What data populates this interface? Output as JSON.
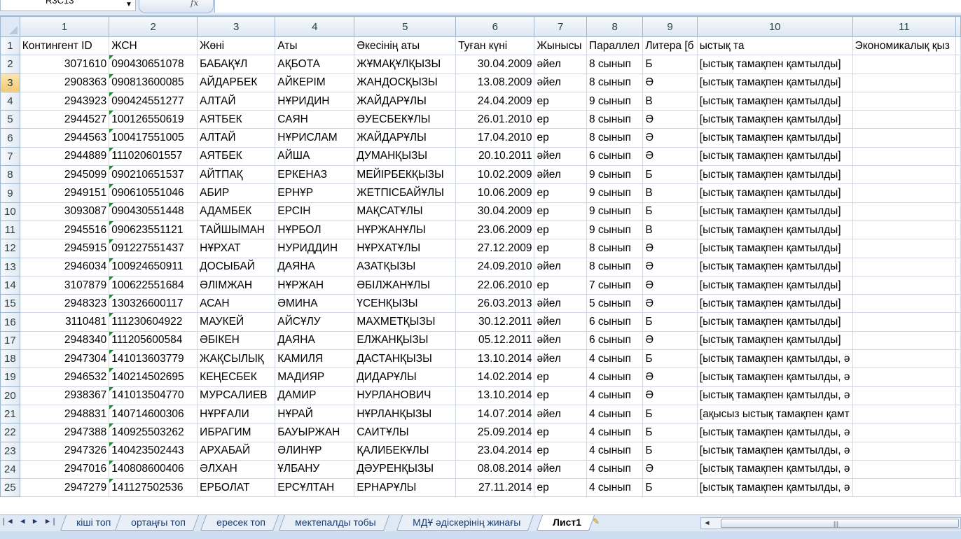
{
  "formula_bar": {
    "name_box": "R3C13",
    "fx_label": "fx",
    "formula": ""
  },
  "grid": {
    "column_headers": [
      "1",
      "2",
      "3",
      "4",
      "5",
      "6",
      "7",
      "8",
      "9",
      "10",
      "11"
    ],
    "header_row": {
      "id": "1",
      "cells": [
        "Контингент ID",
        "ЖСН",
        "Жөні",
        "Аты",
        "Әкесінің аты",
        "Туған күні",
        "Жынысы",
        "Параллел",
        "Литера [б",
        "ыстық та",
        "Экономикалық қыз"
      ]
    },
    "rows": [
      {
        "id": "2",
        "cells": [
          "3071610",
          "090430651078",
          "БАБАҚҰЛ",
          "АҚБОТА",
          "ЖҰМАҚҰЛҚЫЗЫ",
          "30.04.2009",
          "әйел",
          "8 сынып",
          "Б",
          "[ыстық тамақпен қамтылды]",
          ""
        ]
      },
      {
        "id": "3",
        "cells": [
          "2908363",
          "090813600085",
          "АЙДАРБЕК",
          "АЙКЕРІМ",
          "ЖАНДОСҚЫЗЫ",
          "13.08.2009",
          "әйел",
          "8 сынып",
          "Ә",
          "[ыстық тамақпен қамтылды]",
          ""
        ]
      },
      {
        "id": "4",
        "cells": [
          "2943923",
          "090424551277",
          "АЛТАЙ",
          "НҰРИДИН",
          "ЖАЙДАРҰЛЫ",
          "24.04.2009",
          "ер",
          "9 сынып",
          "В",
          "[ыстық тамақпен қамтылды]",
          ""
        ]
      },
      {
        "id": "5",
        "cells": [
          "2944527",
          "100126550619",
          "АЯТБЕК",
          "САЯН",
          "ӘУЕСБЕКҰЛЫ",
          "26.01.2010",
          "ер",
          "8 сынып",
          "Ә",
          "[ыстық тамақпен қамтылды]",
          ""
        ]
      },
      {
        "id": "6",
        "cells": [
          "2944563",
          "100417551005",
          "АЛТАЙ",
          "НҰРИСЛАМ",
          "ЖАЙДАРҰЛЫ",
          "17.04.2010",
          "ер",
          "8 сынып",
          "Ә",
          "[ыстық тамақпен қамтылды]",
          ""
        ]
      },
      {
        "id": "7",
        "cells": [
          "2944889",
          "111020601557",
          "АЯТБЕК",
          "АЙША",
          "ДУМАНҚЫЗЫ",
          "20.10.2011",
          "әйел",
          "6 сынып",
          "Ә",
          "[ыстық тамақпен қамтылды]",
          ""
        ]
      },
      {
        "id": "8",
        "cells": [
          "2945099",
          "090210651537",
          "АЙТПАҚ",
          "ЕРКЕНАЗ",
          "МЕЙІРБЕКҚЫЗЫ",
          "10.02.2009",
          "әйел",
          "9 сынып",
          "Б",
          "[ыстық тамақпен қамтылды]",
          ""
        ]
      },
      {
        "id": "9",
        "cells": [
          "2949151",
          "090610551046",
          "АБИР",
          "ЕРНҰР",
          "ЖЕТПІСБАЙҰЛЫ",
          "10.06.2009",
          "ер",
          "9 сынып",
          "В",
          "[ыстық тамақпен қамтылды]",
          ""
        ]
      },
      {
        "id": "10",
        "cells": [
          "3093087",
          "090430551448",
          "АДАМБЕК",
          "ЕРСІН",
          "МАҚСАТҰЛЫ",
          "30.04.2009",
          "ер",
          "9 сынып",
          "Б",
          "[ыстық тамақпен қамтылды]",
          ""
        ]
      },
      {
        "id": "11",
        "cells": [
          "2945516",
          "090623551121",
          "ТАЙШЫМАН",
          "НҰРБОЛ",
          "НҰРЖАНҰЛЫ",
          "23.06.2009",
          "ер",
          "9 сынып",
          "В",
          "[ыстық тамақпен қамтылды]",
          ""
        ]
      },
      {
        "id": "12",
        "cells": [
          "2945915",
          "091227551437",
          "НҰРХАТ",
          "НУРИДДИН",
          "НҰРХАТҰЛЫ",
          "27.12.2009",
          "ер",
          "8 сынып",
          "Ә",
          "[ыстық тамақпен қамтылды]",
          ""
        ]
      },
      {
        "id": "13",
        "cells": [
          "2946034",
          "100924650911",
          "ДОСЫБАЙ",
          "ДАЯНА",
          "АЗАТҚЫЗЫ",
          "24.09.2010",
          "әйел",
          "8 сынып",
          "Ә",
          "[ыстық тамақпен қамтылды]",
          ""
        ]
      },
      {
        "id": "14",
        "cells": [
          "3107879",
          "100622551684",
          "ӘЛІМЖАН",
          "НҰРЖАН",
          "ӘБІЛЖАНҰЛЫ",
          "22.06.2010",
          "ер",
          "7 сынып",
          "Ә",
          "[ыстық тамақпен қамтылды]",
          ""
        ]
      },
      {
        "id": "15",
        "cells": [
          "2948323",
          "130326600117",
          "АСАН",
          "ӘМИНА",
          "ҮСЕНҚЫЗЫ",
          "26.03.2013",
          "әйел",
          "5 сынып",
          "Ә",
          "[ыстық тамақпен қамтылды]",
          ""
        ]
      },
      {
        "id": "16",
        "cells": [
          "3110481",
          "111230604922",
          "МАУКЕЙ",
          "АЙСҰЛУ",
          "МАХМЕТҚЫЗЫ",
          "30.12.2011",
          "әйел",
          "6 сынып",
          "Б",
          "[ыстық тамақпен қамтылды]",
          ""
        ]
      },
      {
        "id": "17",
        "cells": [
          "2948340",
          "111205600584",
          "ӘБІКЕН",
          "ДАЯНА",
          "ЕЛЖАНҚЫЗЫ",
          "05.12.2011",
          "әйел",
          "6 сынып",
          "Ә",
          "[ыстық тамақпен қамтылды]",
          ""
        ]
      },
      {
        "id": "18",
        "cells": [
          "2947304",
          "141013603779",
          "ЖАҚСЫЛЫҚ",
          "КАМИЛЯ",
          "ДАСТАНҚЫЗЫ",
          "13.10.2014",
          "әйел",
          "4 сынып",
          "Б",
          "[ыстық тамақпен қамтылды, ә",
          ""
        ]
      },
      {
        "id": "19",
        "cells": [
          "2946532",
          "140214502695",
          "КЕҢЕСБЕК",
          "МАДИЯР",
          "ДИДАРҰЛЫ",
          "14.02.2014",
          "ер",
          "4 сынып",
          "Ә",
          "[ыстық тамақпен қамтылды, ә",
          ""
        ]
      },
      {
        "id": "20",
        "cells": [
          "2938367",
          "141013504770",
          "МУРСАЛИЕВ",
          "ДАМИР",
          "НУРЛАНОВИЧ",
          "13.10.2014",
          "ер",
          "4 сынып",
          "Ә",
          "[ыстық тамақпен қамтылды, ә",
          ""
        ]
      },
      {
        "id": "21",
        "cells": [
          "2948831",
          "140714600306",
          "НҰРҒАЛИ",
          "НҰРАЙ",
          "НҰРЛАНҚЫЗЫ",
          "14.07.2014",
          "әйел",
          "4 сынып",
          "Б",
          "[ақысыз ыстық тамақпен қамт",
          ""
        ]
      },
      {
        "id": "22",
        "cells": [
          "2947388",
          "140925503262",
          "ИБРАГИМ",
          "БАУЫРЖАН",
          "САИТҰЛЫ",
          "25.09.2014",
          "ер",
          "4 сынып",
          "Б",
          "[ыстық тамақпен қамтылды, ә",
          ""
        ]
      },
      {
        "id": "23",
        "cells": [
          "2947326",
          "140423502443",
          "АРХАБАЙ",
          "ӘЛИНҰР",
          "ҚАЛИБЕКҰЛЫ",
          "23.04.2014",
          "ер",
          "4 сынып",
          "Б",
          "[ыстық тамақпен қамтылды, ә",
          ""
        ]
      },
      {
        "id": "24",
        "cells": [
          "2947016",
          "140808600406",
          "ӘЛХАН",
          "ҰЛБАНУ",
          "ДӘУРЕНҚЫЗЫ",
          "08.08.2014",
          "әйел",
          "4 сынып",
          "Ә",
          "[ыстық тамақпен қамтылды, ә",
          ""
        ]
      },
      {
        "id": "25",
        "cells": [
          "2947279",
          "141127502536",
          "ЕРБОЛАТ",
          "ЕРСҰЛТАН",
          "ЕРНАРҰЛЫ",
          "27.11.2014",
          "ер",
          "4 сынып",
          "Б",
          "[ыстық тамақпен қамтылды, ә",
          ""
        ]
      }
    ]
  },
  "sheet_tabs": [
    "кіші топ",
    "ортаңғы топ",
    "ересек топ",
    "мектепалды тобы",
    "МДҰ әдіскерінің жинағы",
    "Лист1"
  ],
  "active_tab": "Лист1",
  "scroll_grip": "|||"
}
